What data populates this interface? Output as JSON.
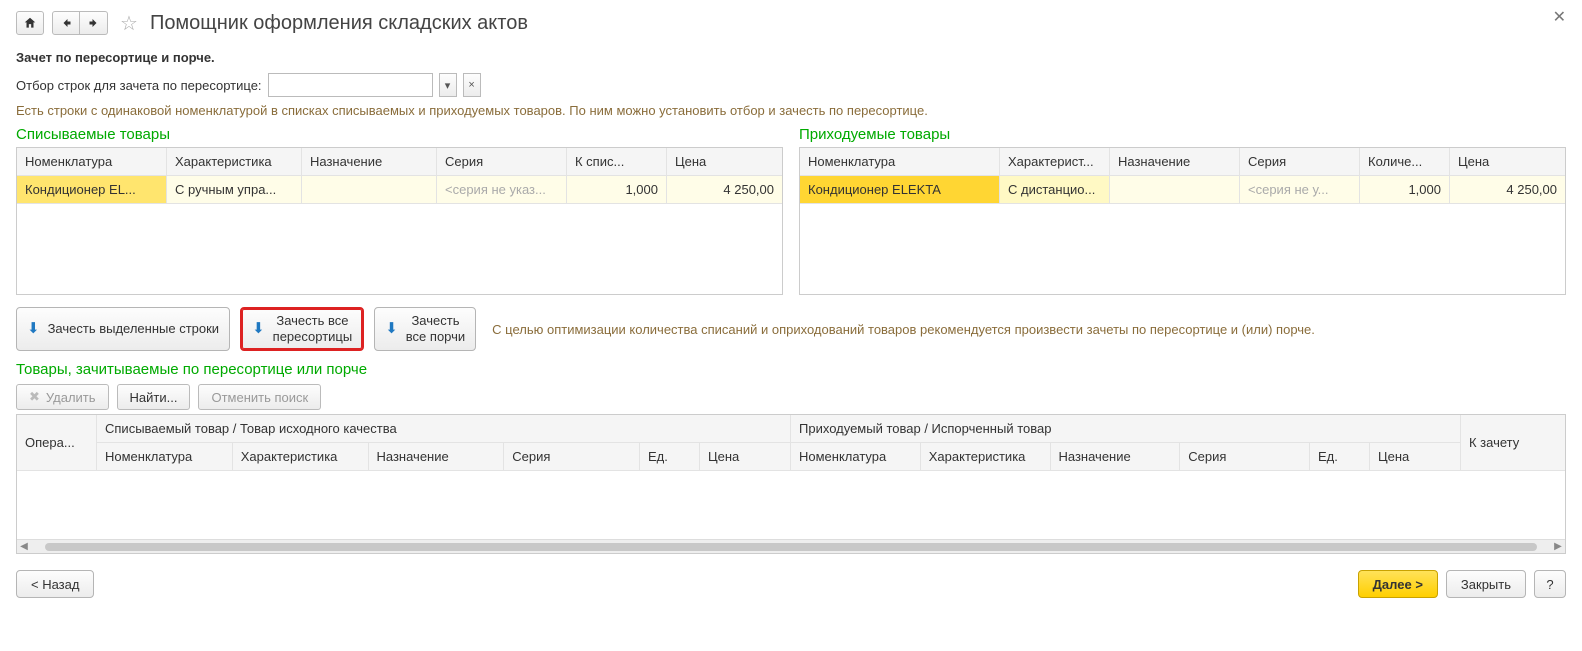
{
  "titlebar": {
    "title": "Помощник оформления складских актов"
  },
  "subtitle": "Зачет по пересортице и порче.",
  "filter": {
    "label": "Отбор строк для зачета по пересортице:",
    "value": ""
  },
  "hint1": "Есть строки с одинаковой номенклатурой в списках списываемых и приходуемых товаров. По ним можно установить отбор и зачесть по пересортице.",
  "pane_left": {
    "title": "Списываемые товары",
    "columns": [
      "Номенклатура",
      "Характеристика",
      "Назначение",
      "Серия",
      "К спис...",
      "Цена"
    ],
    "row": {
      "nomen": "Кондиционер EL...",
      "charact": "С ручным упра...",
      "naz": "",
      "series": "<серия не указ...",
      "qty": "1,000",
      "price": "4 250,00"
    }
  },
  "pane_right": {
    "title": "Приходуемые товары",
    "columns": [
      "Номенклатура",
      "Характерист...",
      "Назначение",
      "Серия",
      "Количе...",
      "Цена"
    ],
    "row": {
      "nomen": "Кондиционер ELEKTA",
      "charact": "С дистанцио...",
      "naz": "",
      "series": "<серия не у...",
      "qty": "1,000",
      "price": "4 250,00"
    }
  },
  "actions": {
    "btn1": "Зачесть выделенные строки",
    "btn2_l1": "Зачесть все",
    "btn2_l2": "пересортицы",
    "btn3_l1": "Зачесть",
    "btn3_l2": "все порчи",
    "hint": "С целью оптимизации количества списаний и оприходований товаров рекомендуется произвести зачеты по пересортице и (или) порче."
  },
  "third": {
    "title": "Товары, зачитываемые по пересортице или порче",
    "btn_delete": "Удалить",
    "btn_find": "Найти...",
    "btn_cancel_find": "Отменить поиск"
  },
  "wide": {
    "oper": "Опера...",
    "group_left": "Списываемый товар / Товар исходного качества",
    "group_right": "Приходуемый товар / Испорченный товар",
    "zachet": "К зачету",
    "sub": [
      "Номенклатура",
      "Характеристика",
      "Назначение",
      "Серия",
      "Ед.",
      "Цена"
    ]
  },
  "footer": {
    "back": "< Назад",
    "next": "Далее >",
    "close": "Закрыть",
    "help": "?"
  }
}
